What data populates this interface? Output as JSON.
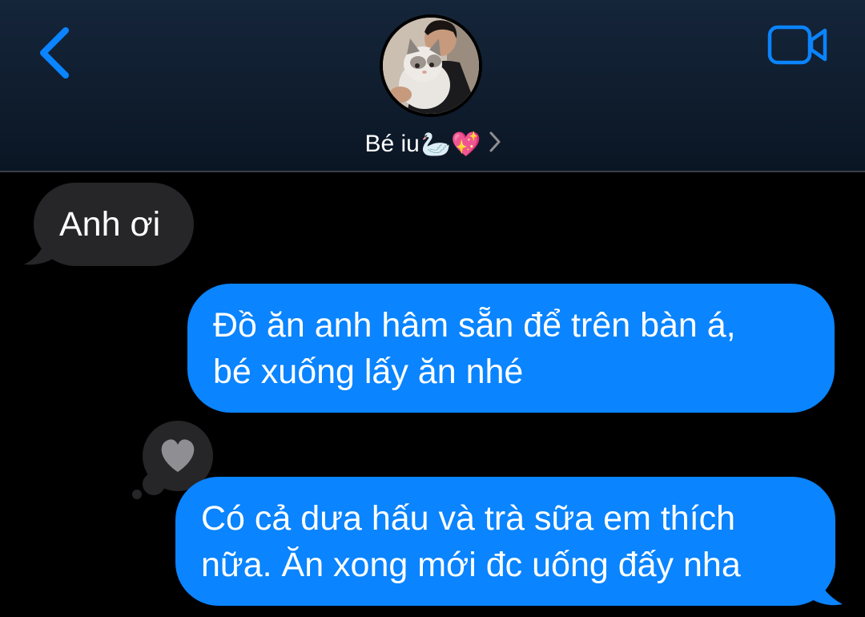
{
  "header": {
    "contact_name": "Bé iu",
    "contact_emoji": "🦢💖",
    "back_icon": "chevron-left-icon",
    "video_icon": "video-camera-icon",
    "accent_color": "#0a84ff"
  },
  "messages": [
    {
      "direction": "received",
      "text": "Anh ơi"
    },
    {
      "direction": "sent",
      "lines": [
        "Đồ ăn anh hâm sẵn để trên bàn á,",
        "bé xuống lấy ăn nhé"
      ]
    },
    {
      "direction": "sent",
      "lines": [
        "Có cả dưa hấu và trà sữa em thích",
        "nữa. Ăn xong mới đc uống đấy nha"
      ],
      "reaction": "heart-icon"
    }
  ],
  "colors": {
    "sent_bubble": "#0a84ff",
    "received_bubble": "#262628",
    "background": "#000000"
  }
}
